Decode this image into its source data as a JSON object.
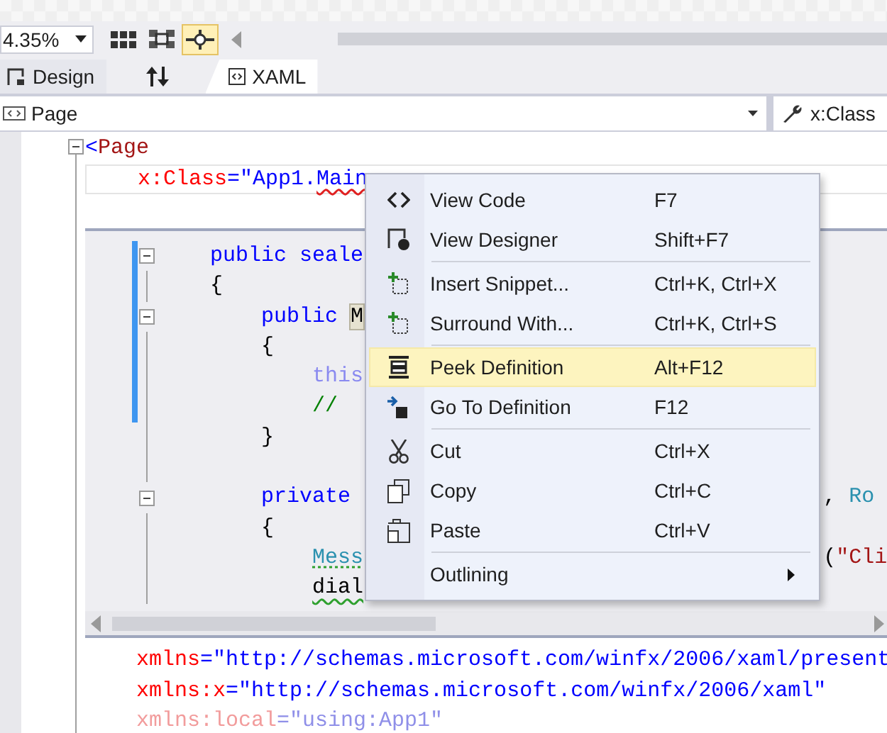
{
  "toolbar": {
    "zoom": "4.35%",
    "buttons": [
      {
        "kind": "grid",
        "selected": false
      },
      {
        "kind": "fit",
        "selected": false
      },
      {
        "kind": "snap",
        "selected": true
      }
    ]
  },
  "tabs": [
    {
      "kind": "design",
      "label": "Design",
      "selected": false
    },
    {
      "kind": "swap"
    },
    {
      "kind": "xaml",
      "label": "XAML",
      "selected": true
    }
  ],
  "navigation": {
    "element": "Page",
    "member": "x:Class"
  },
  "xaml_top": [
    {
      "current": false,
      "tokens": [
        {
          "text": "<",
          "kind": "delim"
        },
        {
          "text": "Page",
          "kind": "name"
        }
      ]
    },
    {
      "current": true,
      "tokens": [
        {
          "text": "    x:Class",
          "kind": "attr"
        },
        {
          "text": "=\"App1.",
          "kind": "value"
        },
        {
          "text": "Main",
          "kind": "value",
          "error": true
        }
      ]
    }
  ],
  "peek": {
    "lines": [
      {
        "changed": true,
        "fold": true,
        "tokens": [
          {
            "text": "    public seale",
            "kind": "keyword"
          }
        ]
      },
      {
        "changed": true,
        "fold": false,
        "tokens": [
          {
            "text": "    {"
          }
        ]
      },
      {
        "changed": true,
        "fold": true,
        "tokens": [
          {
            "text": "        public ",
            "kind": "keyword"
          },
          {
            "text": "M",
            "highlight": true
          }
        ]
      },
      {
        "changed": true,
        "fold": false,
        "tokens": [
          {
            "text": "        {"
          }
        ]
      },
      {
        "changed": true,
        "fold": false,
        "tokens": [
          {
            "text": "            this",
            "kind": "faded"
          }
        ]
      },
      {
        "changed": true,
        "fold": false,
        "tokens": [
          {
            "text": "            //",
            "kind": "comment"
          }
        ]
      },
      {
        "changed": false,
        "fold": false,
        "tokens": [
          {
            "text": "        }"
          }
        ]
      },
      {
        "changed": false,
        "fold": false
      },
      {
        "changed": false,
        "fold": true,
        "tokens": [
          {
            "text": "        private",
            "kind": "keyword"
          }
        ],
        "right": [
          {
            "text": ", "
          },
          {
            "text": "Ro",
            "kind": "type"
          }
        ]
      },
      {
        "changed": false,
        "fold": false,
        "tokens": [
          {
            "text": "        {"
          }
        ]
      },
      {
        "changed": false,
        "fold": false,
        "tokens": [
          {
            "text": "            Mess",
            "kind": "type",
            "suggestion": true
          }
        ],
        "right": [
          {
            "text": "("
          },
          {
            "text": "\"Cli",
            "kind": "string"
          }
        ]
      },
      {
        "changed": false,
        "fold": false,
        "tokens": [
          {
            "text": "            dial",
            "warning": true
          }
        ]
      }
    ]
  },
  "context_menu": [
    {
      "kind": "code",
      "label": "View Code",
      "shortcut": "F7",
      "selected": false,
      "separator_before": false
    },
    {
      "kind": "designer",
      "label": "View Designer",
      "shortcut": "Shift+F7",
      "selected": false,
      "separator_before": false
    },
    {
      "kind": "snippet",
      "label": "Insert Snippet...",
      "shortcut": "Ctrl+K, Ctrl+X",
      "selected": false,
      "separator_before": true
    },
    {
      "kind": "snippet",
      "label": "Surround With...",
      "shortcut": "Ctrl+K, Ctrl+S",
      "selected": false,
      "separator_before": false
    },
    {
      "kind": "peek",
      "label": "Peek Definition",
      "shortcut": "Alt+F12",
      "selected": true,
      "separator_before": true
    },
    {
      "kind": "goto",
      "label": "Go To Definition",
      "shortcut": "F12",
      "selected": false,
      "separator_before": false
    },
    {
      "kind": "cut",
      "label": "Cut",
      "shortcut": "Ctrl+X",
      "selected": false,
      "separator_before": true
    },
    {
      "kind": "copy",
      "label": "Copy",
      "shortcut": "Ctrl+C",
      "selected": false,
      "separator_before": false
    },
    {
      "kind": "paste",
      "label": "Paste",
      "shortcut": "Ctrl+V",
      "selected": false,
      "separator_before": false
    },
    {
      "kind": "submenu",
      "label": "Outlining",
      "selected": false,
      "separator_before": true
    }
  ],
  "xaml_bottom": [
    {
      "tokens": [
        {
          "text": "    xmlns",
          "kind": "attr"
        },
        {
          "text": "=\"http://schemas.microsoft.com/winfx/2006/xaml/present",
          "kind": "value"
        }
      ]
    },
    {
      "tokens": [
        {
          "text": "    xmlns:x",
          "kind": "attr"
        },
        {
          "text": "=\"http://schemas.microsoft.com/winfx/2006/xaml\"",
          "kind": "value"
        }
      ]
    },
    {
      "tokens": [
        {
          "text": "    xmlns:local",
          "kind": "attr-dim"
        },
        {
          "text": "=\"using:App1\"",
          "kind": "value-dim"
        }
      ]
    }
  ]
}
